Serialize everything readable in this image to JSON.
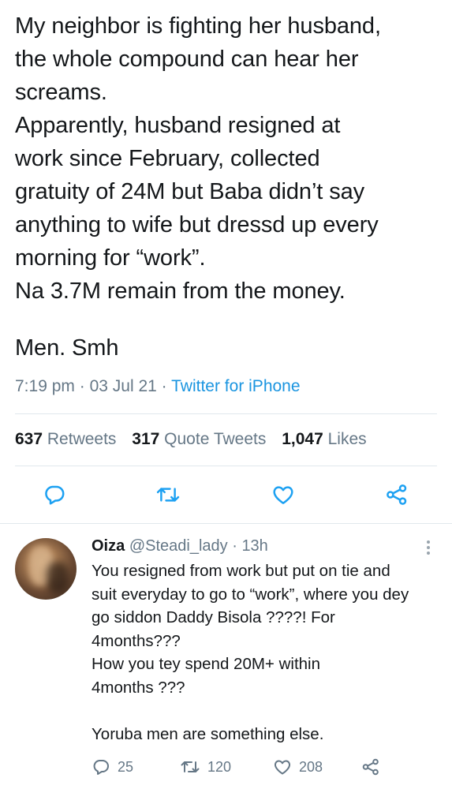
{
  "tweet": {
    "lines": [
      "My neighbor is fighting her husband,",
      "the whole compound can hear her",
      "screams.",
      "Apparently, husband resigned at",
      "work since February, collected",
      "gratuity of 24M but Baba didn’t say",
      "anything to wife but dressd up every",
      "morning for “work”.",
      "Na 3.7M remain from the money."
    ],
    "closing": "Men. Smh",
    "time": "7:19 pm",
    "date": "03 Jul 21",
    "separator": "·",
    "source": "Twitter for iPhone",
    "retweets_count": "637",
    "retweets_label": "Retweets",
    "quotes_count": "317",
    "quotes_label": "Quote Tweets",
    "likes_count": "1,047",
    "likes_label": "Likes"
  },
  "reply": {
    "name": "Oiza",
    "handle": "@Steadi_lady",
    "separator": "·",
    "age": "13h",
    "lines": [
      "You resigned from work but  put on tie and",
      "suit everyday to go to “work”, where you dey",
      "go siddon Daddy Bisola ????! For",
      "4months???",
      "How you tey spend 20M+ within",
      "4months ???"
    ],
    "closing": "Yoruba men are something else.",
    "replies": "25",
    "retweets": "120",
    "likes": "208"
  },
  "icons": {
    "reply": "reply-icon",
    "retweet": "retweet-icon",
    "like": "heart-icon",
    "share": "share-icon",
    "more": "more-vertical-icon"
  },
  "colors": {
    "text": "#14171a",
    "muted": "#657786",
    "accent": "#1da1f2",
    "link": "#1b95e0",
    "divider": "#e1e8ed"
  }
}
